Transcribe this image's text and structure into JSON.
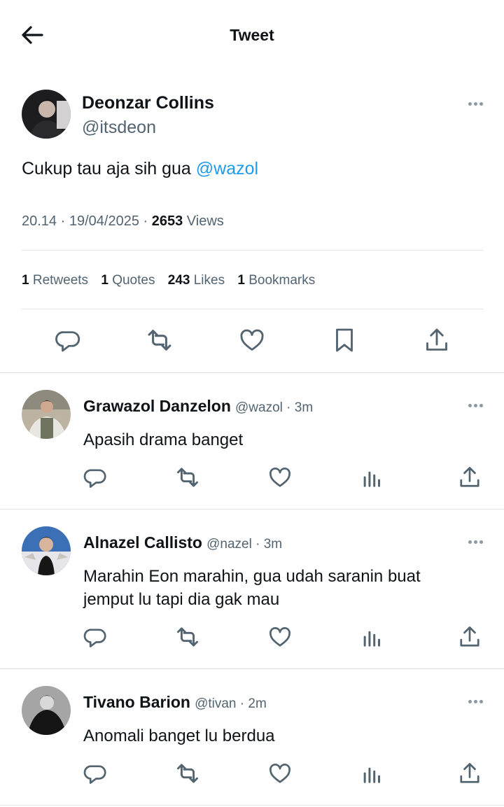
{
  "header": {
    "title": "Tweet"
  },
  "main_tweet": {
    "author_name": "Deonzar Collins",
    "author_handle": "@itsdeon",
    "text": "Cukup tau aja sih gua ",
    "mention": "@wazol",
    "time": "20.14",
    "date": "19/04/2025",
    "views_count": "2653",
    "views_label": "Views",
    "stats": {
      "retweets_count": "1",
      "retweets_label": "Retweets",
      "quotes_count": "1",
      "quotes_label": "Quotes",
      "likes_count": "243",
      "likes_label": "Likes",
      "bookmarks_count": "1",
      "bookmarks_label": "Bookmarks"
    }
  },
  "replies": [
    {
      "name": "Grawazol Danzelon",
      "handle": "@wazol",
      "time": "3m",
      "text": "Apasih drama banget"
    },
    {
      "name": "Alnazel Callisto",
      "handle": "@nazel",
      "time": "3m",
      "text": "Marahin Eon marahin, gua udah saranin buat jemput lu tapi dia gak mau"
    },
    {
      "name": "Tivano Barion",
      "handle": "@tivan",
      "time": "2m",
      "text": "Anomali banget lu berdua"
    }
  ],
  "icons": {
    "back": "arrow-left-icon",
    "more": "more-horizontal-icon",
    "reply": "reply-bubble-icon",
    "retweet": "retweet-icon",
    "like": "heart-icon",
    "bookmark": "bookmark-icon",
    "views": "bar-chart-icon",
    "share": "share-upload-icon"
  },
  "colors": {
    "accent": "#1d9bf0",
    "secondary_text": "#536471",
    "icon": "#536471",
    "divider": "#dfe3e6"
  }
}
